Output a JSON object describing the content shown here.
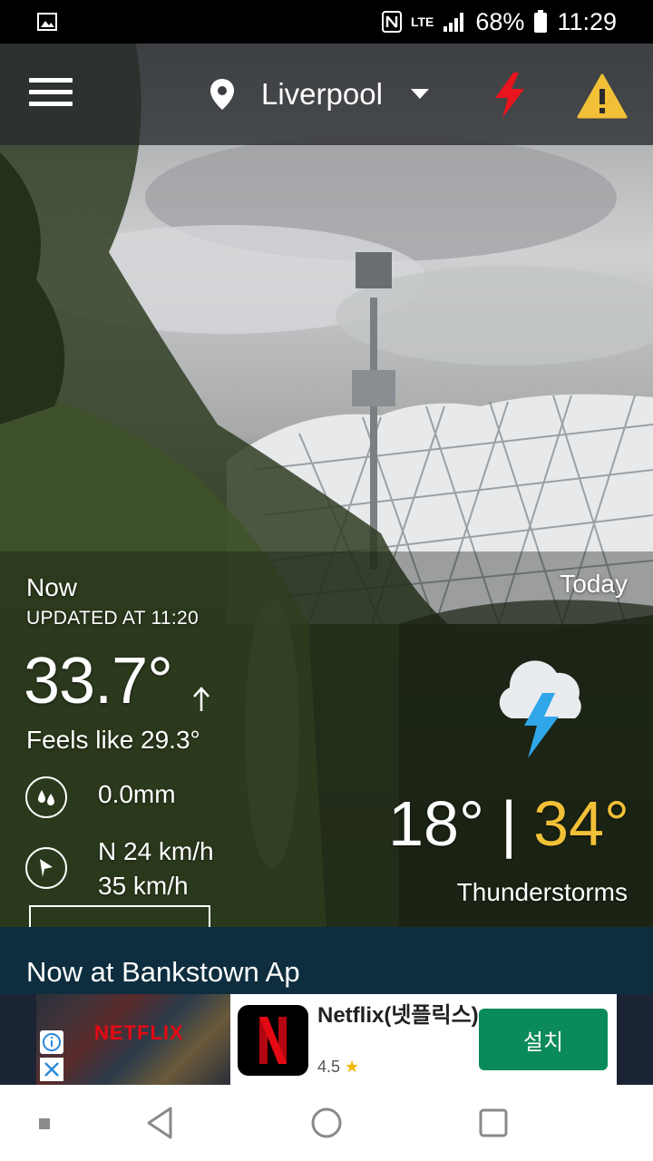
{
  "status_bar": {
    "battery": "68%",
    "time": "11:29",
    "network": "LTE"
  },
  "header": {
    "location": "Liverpool",
    "icons": [
      "menu-icon",
      "location-pin-icon",
      "chevron-down-icon",
      "lightning-icon",
      "warning-icon"
    ],
    "colors": {
      "bolt": "#e8141e",
      "warning": "#f2c037"
    }
  },
  "now": {
    "label": "Now",
    "updated": "UPDATED AT 11:20",
    "temperature": "33.7°",
    "feels_like": "Feels like 29.3°",
    "rain": "0.0mm",
    "wind_speed": "N 24 km/h",
    "wind_gust": "35 km/h"
  },
  "today": {
    "label": "Today",
    "min": "18°",
    "separator": "|",
    "max": "34°",
    "summary": "Thunderstorms",
    "max_color": "#f2c037"
  },
  "section": {
    "title": "Now at Bankstown Ap"
  },
  "ad": {
    "art_text": "NETFLIX",
    "title": "Netflix(넷플릭스)",
    "rating": "4.5",
    "install_label": "설치",
    "install_color": "#0b8a5a"
  }
}
